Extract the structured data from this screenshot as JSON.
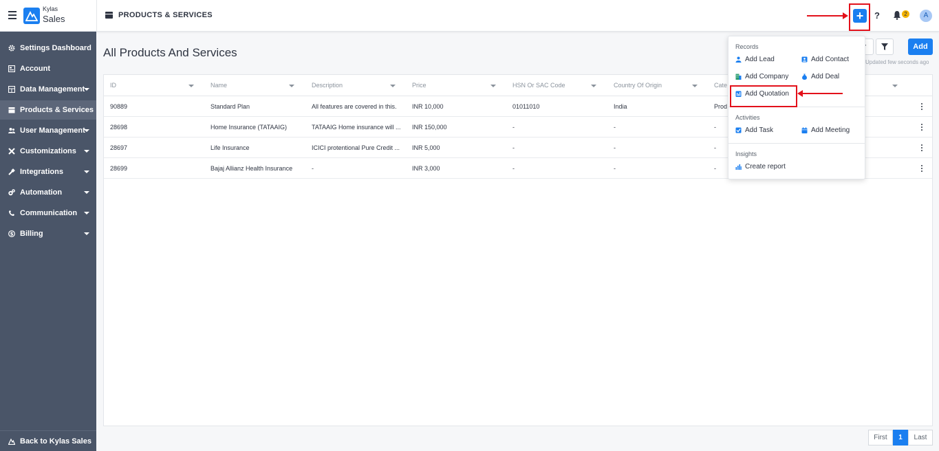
{
  "header": {
    "brand_top": "Kylas",
    "brand_bottom": "Sales",
    "page_heading": "PRODUCTS & SERVICES",
    "help_label": "?",
    "notification_count": "2",
    "avatar_initial": "A"
  },
  "sidebar": {
    "items": [
      {
        "label": "Settings Dashboard",
        "icon": "gear-icon",
        "expandable": false
      },
      {
        "label": "Account",
        "icon": "account-icon",
        "expandable": false
      },
      {
        "label": "Data Management",
        "icon": "table-icon",
        "expandable": true
      },
      {
        "label": "Products & Services",
        "icon": "box-icon",
        "expandable": false,
        "active": true
      },
      {
        "label": "User Management",
        "icon": "users-icon",
        "expandable": true
      },
      {
        "label": "Customizations",
        "icon": "tools-icon",
        "expandable": true
      },
      {
        "label": "Integrations",
        "icon": "plug-icon",
        "expandable": true
      },
      {
        "label": "Automation",
        "icon": "cogs-icon",
        "expandable": true
      },
      {
        "label": "Communication",
        "icon": "phone-icon",
        "expandable": true
      },
      {
        "label": "Billing",
        "icon": "dollar-icon",
        "expandable": true
      }
    ],
    "back_label": "Back to Kylas Sales"
  },
  "main": {
    "title": "All Products And Services",
    "add_label": "Add",
    "updated_text": "Updated few seconds ago"
  },
  "table": {
    "columns": [
      "ID",
      "Name",
      "Description",
      "Price",
      "HSN Or SAC Code",
      "Country Of Origin",
      "Cate"
    ],
    "rows": [
      [
        "90889",
        "Standard Plan",
        "All features are covered in this.",
        "INR 10,000",
        "01011010",
        "India",
        "Prod"
      ],
      [
        "28698",
        "Home Insurance (TATAAIG)",
        "TATAAIG Home insurance will ...",
        "INR 150,000",
        "-",
        "-",
        "-"
      ],
      [
        "28697",
        "Life Insurance",
        "ICICI protentional Pure Credit ...",
        "INR 5,000",
        "-",
        "-",
        "-"
      ],
      [
        "28699",
        "Bajaj Allianz Health Insurance",
        "-",
        "INR 3,000",
        "-",
        "-",
        "-"
      ]
    ]
  },
  "pagination": {
    "first": "First",
    "current": "1",
    "last": "Last"
  },
  "dropdown": {
    "records_label": "Records",
    "add_lead": "Add Lead",
    "add_contact": "Add Contact",
    "add_company": "Add Company",
    "add_deal": "Add Deal",
    "add_quotation": "Add Quotation",
    "activities_label": "Activities",
    "add_task": "Add Task",
    "add_meeting": "Add Meeting",
    "insights_label": "Insights",
    "create_report": "Create report"
  },
  "colors": {
    "primary": "#1b7ff0",
    "sidebar": "#4a5568",
    "highlight": "#e3101a",
    "badge": "#f5b300"
  }
}
